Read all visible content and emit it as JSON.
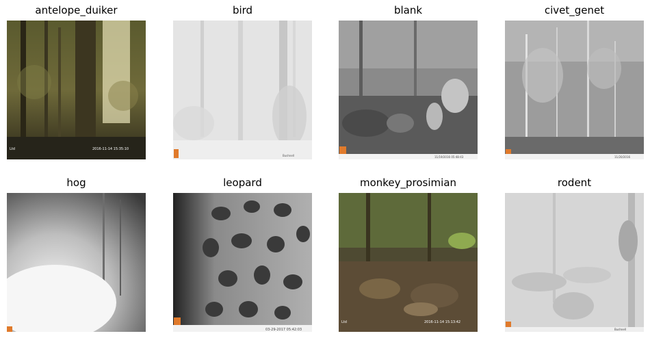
{
  "grid": {
    "panels": [
      {
        "label": "antelope_duiker"
      },
      {
        "label": "bird"
      },
      {
        "label": "blank"
      },
      {
        "label": "civet_genet"
      },
      {
        "label": "hog"
      },
      {
        "label": "leopard"
      },
      {
        "label": "monkey_prosimian"
      },
      {
        "label": "rodent"
      }
    ]
  }
}
